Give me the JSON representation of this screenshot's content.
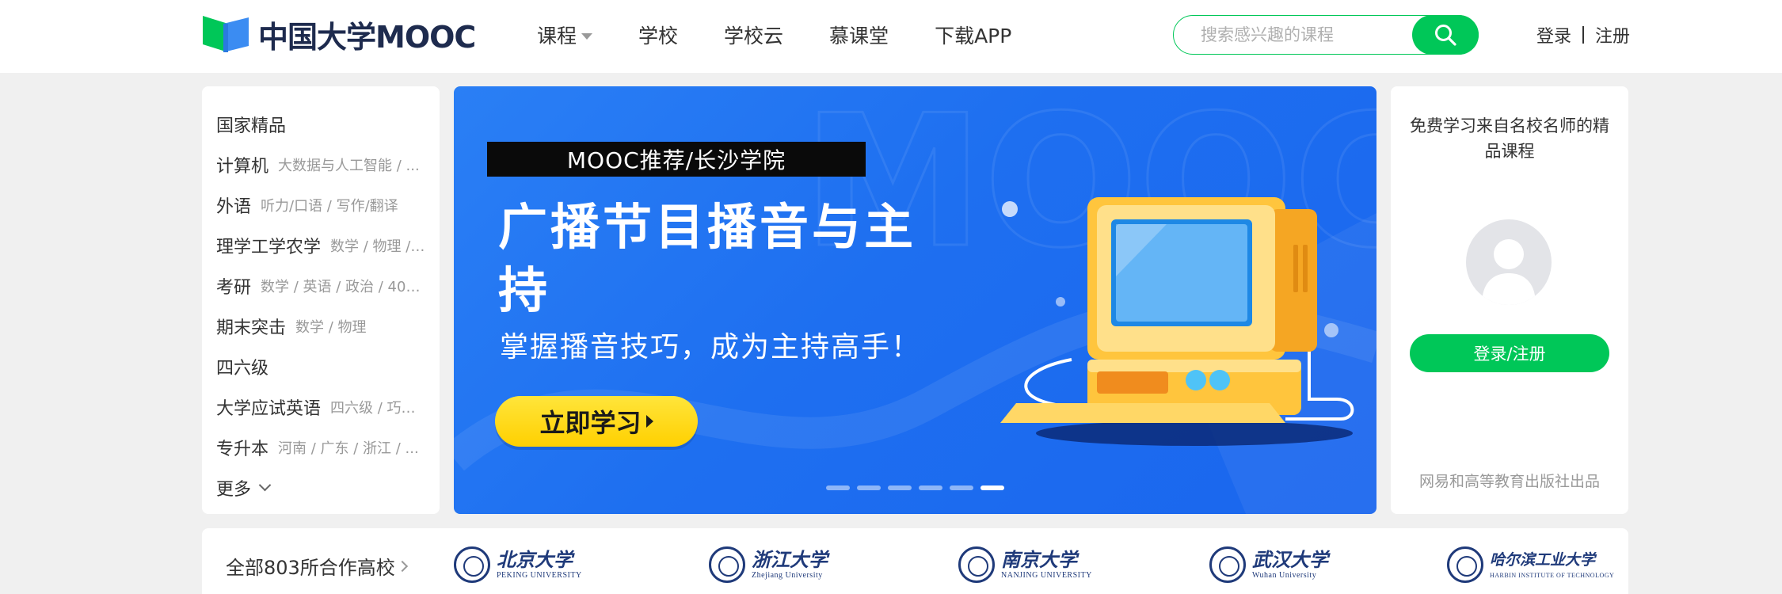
{
  "brand": {
    "logo_text": "中国大学MOOC",
    "green": "#00c758",
    "navy": "#1e2b4e"
  },
  "nav": [
    {
      "label": "课程",
      "has_dropdown": true
    },
    {
      "label": "学校"
    },
    {
      "label": "学校云"
    },
    {
      "label": "慕课堂"
    },
    {
      "label": "下载APP"
    }
  ],
  "search": {
    "placeholder": "搜索感兴趣的课程",
    "icon": "search-icon"
  },
  "auth": {
    "login": "登录",
    "register": "注册"
  },
  "categories": [
    {
      "main": "国家精品",
      "sub": ""
    },
    {
      "main": "计算机",
      "sub": "大数据与人工智能 / ..."
    },
    {
      "main": "外语",
      "sub": "听力/口语 / 写作/翻译"
    },
    {
      "main": "理学工学农学",
      "sub": "数学 / 物理 / ..."
    },
    {
      "main": "考研",
      "sub": "数学 / 英语 / 政治 / 408..."
    },
    {
      "main": "期末突击",
      "sub": "数学 / 物理"
    },
    {
      "main": "四六级",
      "sub": ""
    },
    {
      "main": "大学应试英语",
      "sub": "四六级 / 巧记..."
    },
    {
      "main": "专升本",
      "sub": "河南 / 广东 / 浙江 / ..."
    }
  ],
  "categories_more": "更多",
  "banner": {
    "tag": "MOOC推荐/长沙学院",
    "title": "广播节目播音与主持",
    "subtitle": "掌握播音技巧，成为主持高手！",
    "cta": "立即学习",
    "dots_total": 6,
    "dots_active_index": 5,
    "bg_color": "#1e6ff0",
    "cta_color": "#ffd000"
  },
  "login_panel": {
    "title": "免费学习来自名校名师的精品课程",
    "button": "登录/注册",
    "footer": "网易和高等教育出版社出品"
  },
  "schools": {
    "all_label": "全部803所合作高校",
    "items": [
      {
        "cn": "北京大学",
        "en": "PEKING UNIVERSITY"
      },
      {
        "cn": "浙江大学",
        "en": "Zhejiang University"
      },
      {
        "cn": "南京大学",
        "en": "NANJING UNIVERSITY"
      },
      {
        "cn": "武汉大学",
        "en": "Wuhan University"
      },
      {
        "cn": "哈尔滨工业大学",
        "en": "HARBIN INSTITUTE OF TECHNOLOGY"
      }
    ]
  }
}
